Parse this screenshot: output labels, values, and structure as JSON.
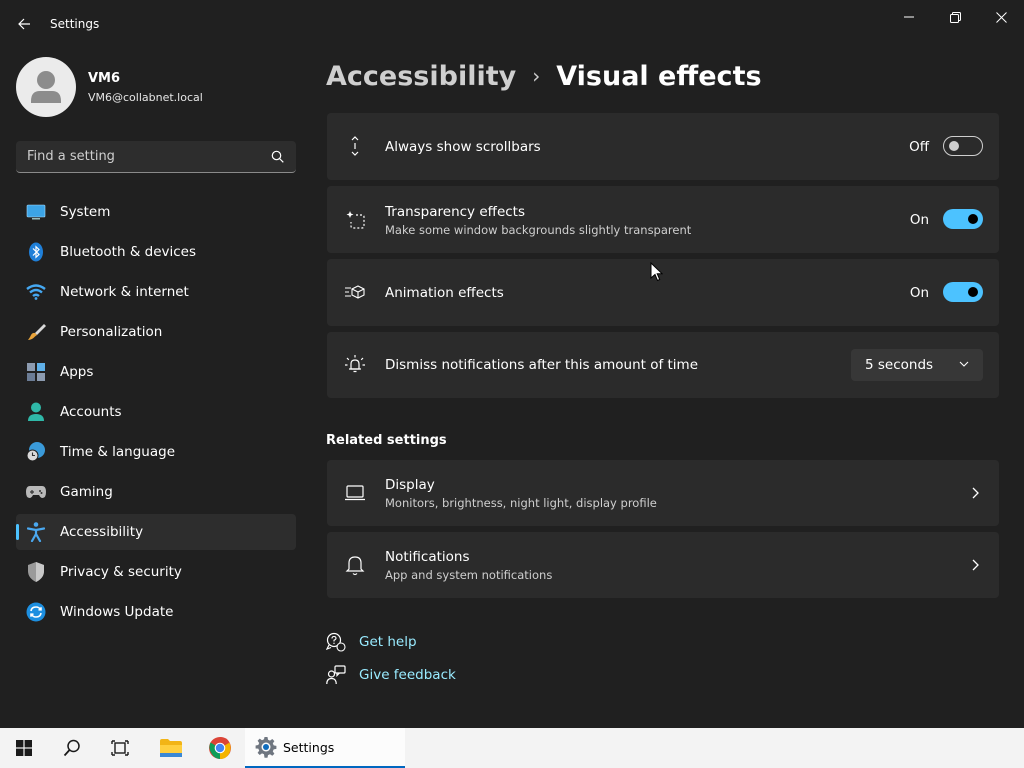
{
  "window": {
    "title": "Settings",
    "icons": {
      "back": "back-arrow-icon",
      "minimize": "minimize-icon",
      "restore": "restore-icon",
      "close": "close-icon"
    }
  },
  "profile": {
    "name": "VM6",
    "email": "VM6@collabnet.local"
  },
  "search": {
    "placeholder": "Find a setting"
  },
  "sidebar": {
    "items": [
      {
        "label": "System",
        "icon": "monitor-icon"
      },
      {
        "label": "Bluetooth & devices",
        "icon": "bluetooth-icon"
      },
      {
        "label": "Network & internet",
        "icon": "wifi-icon"
      },
      {
        "label": "Personalization",
        "icon": "brush-icon"
      },
      {
        "label": "Apps",
        "icon": "apps-icon"
      },
      {
        "label": "Accounts",
        "icon": "person-icon"
      },
      {
        "label": "Time & language",
        "icon": "clock-globe-icon"
      },
      {
        "label": "Gaming",
        "icon": "gamepad-icon"
      },
      {
        "label": "Accessibility",
        "icon": "accessibility-icon",
        "active": true
      },
      {
        "label": "Privacy & security",
        "icon": "shield-icon"
      },
      {
        "label": "Windows Update",
        "icon": "update-icon"
      }
    ]
  },
  "breadcrumb": {
    "parent": "Accessibility",
    "separator": "›",
    "current": "Visual effects"
  },
  "settings": {
    "scrollbars": {
      "title": "Always show scrollbars",
      "state": "Off",
      "on": false
    },
    "transparency": {
      "title": "Transparency effects",
      "subtitle": "Make some window backgrounds slightly transparent",
      "state": "On",
      "on": true
    },
    "animation": {
      "title": "Animation effects",
      "state": "On",
      "on": true
    },
    "dismiss": {
      "title": "Dismiss notifications after this amount of time",
      "value": "5 seconds"
    }
  },
  "related": {
    "heading": "Related settings",
    "display": {
      "title": "Display",
      "subtitle": "Monitors, brightness, night light, display profile"
    },
    "notifications": {
      "title": "Notifications",
      "subtitle": "App and system notifications"
    }
  },
  "help": {
    "get_help": "Get help",
    "give_feedback": "Give feedback"
  },
  "taskbar": {
    "active_app": "Settings"
  },
  "colors": {
    "background": "#202020",
    "card": "#2b2b2b",
    "accent": "#4cc2ff",
    "link": "#99ebff"
  }
}
